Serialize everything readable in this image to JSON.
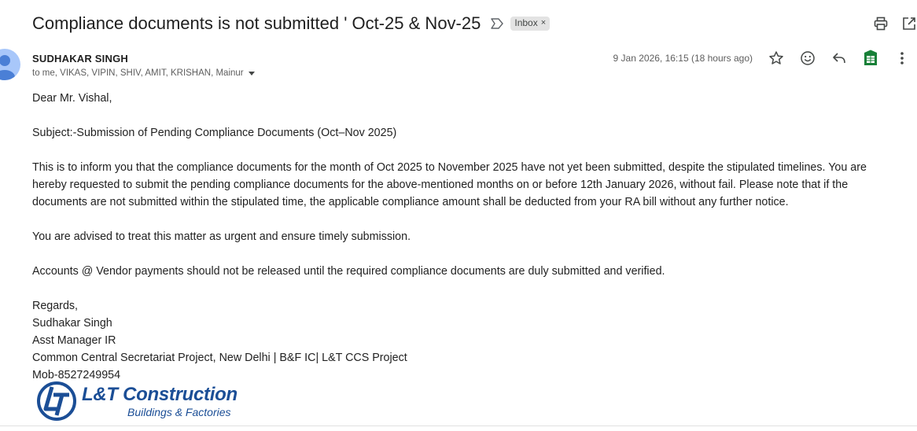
{
  "email": {
    "subject": "Compliance documents is not submitted ' Oct-25 & Nov-25",
    "label": "Inbox",
    "label_close": "×",
    "sender_name": "SUDHAKAR SINGH",
    "recipients": "to me, VIKAS, VIPIN, SHIV, AMIT, KRISHAN, Mainur",
    "date": "9 Jan 2026, 16:15 (18 hours ago)"
  },
  "icons": {
    "important": "important-icon",
    "print": "print-icon",
    "open_new_window": "open-in-new-icon",
    "star": "star-icon",
    "emoji": "emoji-icon",
    "reply": "reply-icon",
    "sheets": "sheets-icon",
    "more": "more-vert-icon"
  },
  "body": {
    "greeting": "Dear Mr. Vishal,",
    "subject_line": "Subject:-Submission of Pending Compliance Documents (Oct–Nov 2025)",
    "paragraph1": "This is to inform you that the compliance documents for the month of Oct 2025 to November 2025 have not yet been submitted, despite the stipulated timelines. You are hereby requested to submit the pending compliance documents for the above-mentioned months on or before 12th January 2026, without fail. Please note that if the documents are not submitted within the stipulated time, the applicable compliance amount shall be deducted from your RA bill without any further notice.",
    "paragraph2": "You are advised to treat this matter as urgent and ensure timely submission.",
    "paragraph3": "Accounts @ Vendor payments should not be released until the required compliance documents are duly submitted and verified.",
    "signature": {
      "closing": "Regards,",
      "name": "Sudhakar Singh",
      "title": "Asst Manager IR",
      "org": "Common Central Secretariat Project, New Delhi | B&F IC| L&T CCS Project",
      "mobile": "Mob-8527249954"
    }
  },
  "logo": {
    "main": "L&T Construction",
    "sub": "Buildings & Factories"
  },
  "colors": {
    "brand_blue": "#1b4e96",
    "avatar_bg": "#a8c7fa",
    "sheets_green": "#188038"
  }
}
